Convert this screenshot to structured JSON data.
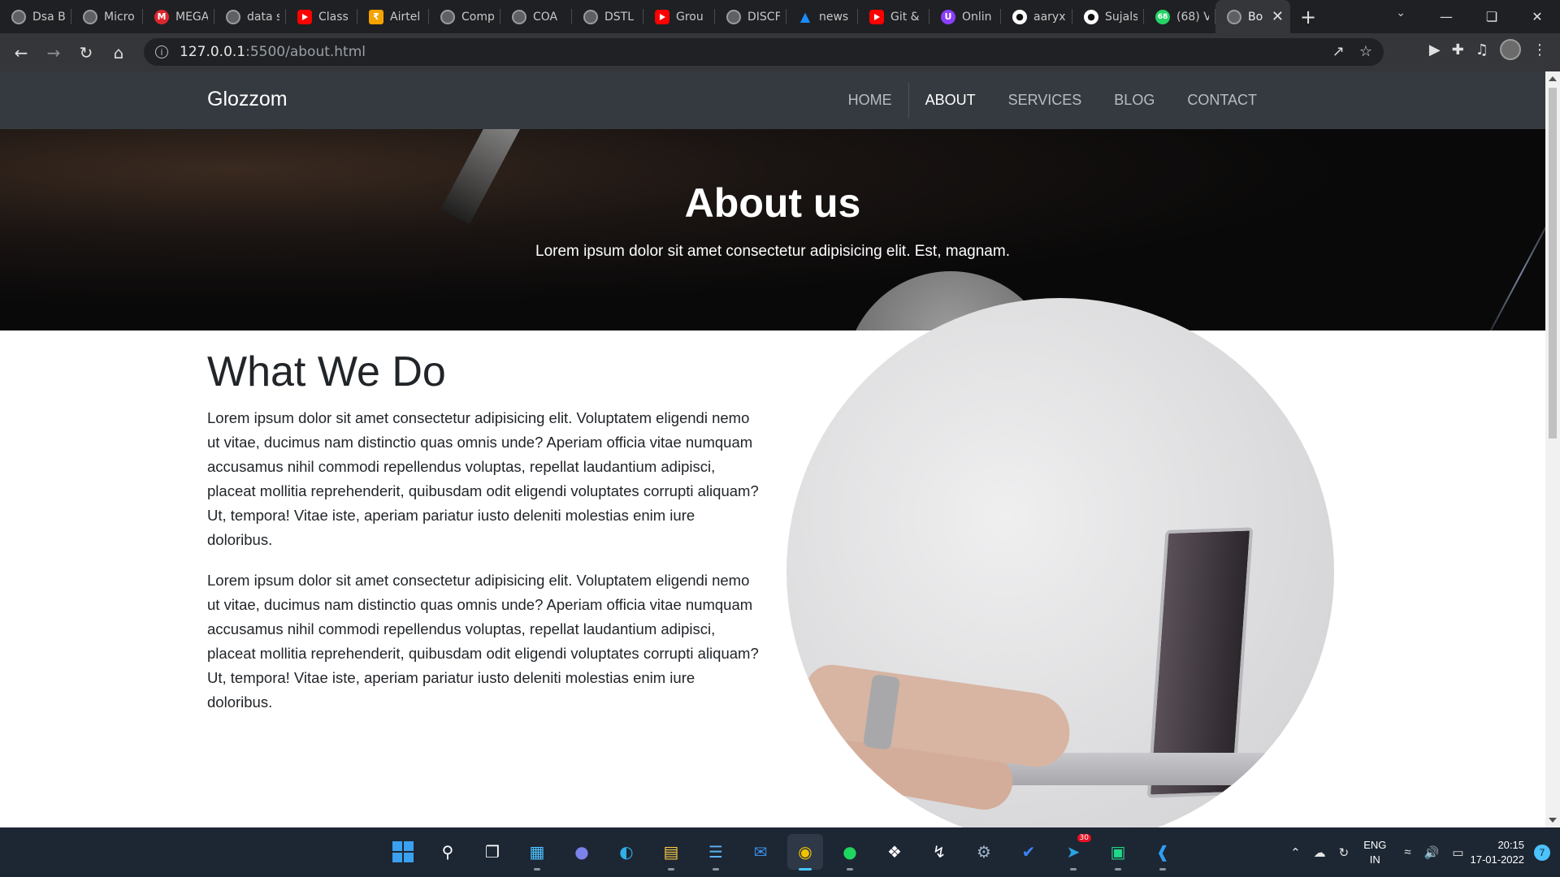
{
  "browser": {
    "tabs": [
      {
        "label": "Dsa B",
        "icon": "globe-icon"
      },
      {
        "label": "Micro",
        "icon": "globe-icon"
      },
      {
        "label": "MEGA",
        "icon": "mega-icon"
      },
      {
        "label": "data s",
        "icon": "globe-icon"
      },
      {
        "label": "Class",
        "icon": "youtube-icon"
      },
      {
        "label": "Airtel",
        "icon": "rupee-icon"
      },
      {
        "label": "Comp",
        "icon": "globe-icon"
      },
      {
        "label": "COA",
        "icon": "globe-icon"
      },
      {
        "label": "DSTL",
        "icon": "globe-icon"
      },
      {
        "label": "Grou",
        "icon": "youtube-icon"
      },
      {
        "label": "DISCF",
        "icon": "globe-icon"
      },
      {
        "label": "news",
        "icon": "news-icon"
      },
      {
        "label": "Git &",
        "icon": "youtube-icon"
      },
      {
        "label": "Onlin",
        "icon": "u-icon"
      },
      {
        "label": "aaryx",
        "icon": "github-icon"
      },
      {
        "label": "Sujals",
        "icon": "github-icon"
      },
      {
        "label": "(68) V",
        "icon": "whatsapp-icon",
        "badge": "68"
      },
      {
        "label": "Bo",
        "icon": "globe-icon",
        "active": true
      }
    ],
    "url_host": "127.0.0.1",
    "url_path": ":5500/about.html"
  },
  "site": {
    "brand": "Glozzom",
    "nav": [
      "HOME",
      "ABOUT",
      "SERVICES",
      "BLOG",
      "CONTACT"
    ],
    "active_nav": "ABOUT",
    "hero": {
      "title": "About us",
      "subtitle": "Lorem ipsum dolor sit amet consectetur adipisicing elit. Est, magnam."
    },
    "section": {
      "heading": "What We Do",
      "paragraphs": [
        "Lorem ipsum dolor sit amet consectetur adipisicing elit. Voluptatem eligendi nemo ut vitae, ducimus nam distinctio quas omnis unde? Aperiam officia vitae numquam accusamus nihil commodi repellendus voluptas, repellat laudantium adipisci, placeat mollitia reprehenderit, quibusdam odit eligendi voluptates corrupti aliquam? Ut, tempora! Vitae iste, aperiam pariatur iusto deleniti molestias enim iure doloribus.",
        "Lorem ipsum dolor sit amet consectetur adipisicing elit. Voluptatem eligendi nemo ut vitae, ducimus nam distinctio quas omnis unde? Aperiam officia vitae numquam accusamus nihil commodi repellendus voluptas, repellat laudantium adipisci, placeat mollitia reprehenderit, quibusdam odit eligendi voluptates corrupti aliquam? Ut, tempora! Vitae iste, aperiam pariatur iusto deleniti molestias enim iure doloribus."
      ]
    }
  },
  "taskbar": {
    "telegram_badge": "30",
    "language": "ENG",
    "region": "IN",
    "time": "20:15",
    "date": "17-01-2022",
    "notification_count": "7"
  },
  "colors": {
    "navbar": "#343a40",
    "tab_strip": "#1f2023",
    "toolbar": "#35363a",
    "taskbar": "#1d2633",
    "accent": "#4cc2ff"
  }
}
